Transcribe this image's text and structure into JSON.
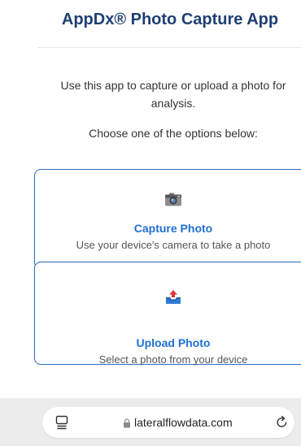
{
  "app": {
    "title": "AppDx® Photo Capture App",
    "intro": "Use this app to capture or upload a photo for analysis.",
    "choose": "Choose one of the options below:"
  },
  "options": [
    {
      "icon": "camera-icon",
      "title": "Capture Photo",
      "description": "Use your device's camera to take a photo"
    },
    {
      "icon": "upload-tray-icon",
      "title": "Upload Photo",
      "description": "Select a photo from your device"
    }
  ],
  "browser": {
    "url": "lateralflowdata.com",
    "icons": [
      "tabs-icon",
      "lock-icon",
      "reload-icon"
    ]
  },
  "colors": {
    "title": "#1f3f73",
    "accent": "#1f6fd1",
    "card_border": "#2d6ab8",
    "toolbar_bg": "#ececec"
  }
}
